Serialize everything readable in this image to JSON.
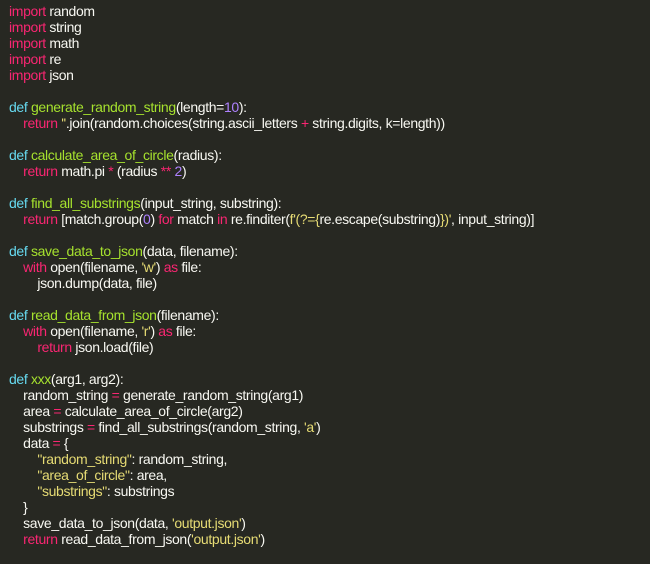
{
  "editor": {
    "colors": {
      "background": "#272822",
      "keyword": "#f92672",
      "function": "#a6e22e",
      "number": "#ae81ff",
      "string": "#e6db74",
      "text": "#f8f8f2",
      "builtin": "#66d9ef"
    },
    "lines": [
      [
        [
          "k",
          "import"
        ],
        [
          "t",
          " random"
        ]
      ],
      [
        [
          "k",
          "import"
        ],
        [
          "t",
          " string"
        ]
      ],
      [
        [
          "k",
          "import"
        ],
        [
          "t",
          " math"
        ]
      ],
      [
        [
          "k",
          "import"
        ],
        [
          "t",
          " re"
        ]
      ],
      [
        [
          "k",
          "import"
        ],
        [
          "t",
          " json"
        ]
      ],
      [],
      [
        [
          "b",
          "def "
        ],
        [
          "f",
          "generate_random_string"
        ],
        [
          "t",
          "(length="
        ],
        [
          "n",
          "10"
        ],
        [
          "t",
          "):"
        ]
      ],
      [
        [
          "t",
          "    "
        ],
        [
          "k",
          "return"
        ],
        [
          "t",
          " "
        ],
        [
          "s",
          "''"
        ],
        [
          "t",
          ".join(random.choices(string.ascii_letters "
        ],
        [
          "k",
          "+"
        ],
        [
          "t",
          " string.digits, k=length))"
        ]
      ],
      [],
      [
        [
          "b",
          "def "
        ],
        [
          "f",
          "calculate_area_of_circle"
        ],
        [
          "t",
          "(radius):"
        ]
      ],
      [
        [
          "t",
          "    "
        ],
        [
          "k",
          "return"
        ],
        [
          "t",
          " math.pi "
        ],
        [
          "k",
          "*"
        ],
        [
          "t",
          " (radius "
        ],
        [
          "k",
          "**"
        ],
        [
          "t",
          " "
        ],
        [
          "n",
          "2"
        ],
        [
          "t",
          ")"
        ]
      ],
      [],
      [
        [
          "b",
          "def "
        ],
        [
          "f",
          "find_all_substrings"
        ],
        [
          "t",
          "(input_string, substring):"
        ]
      ],
      [
        [
          "t",
          "    "
        ],
        [
          "k",
          "return"
        ],
        [
          "t",
          " [match.group("
        ],
        [
          "n",
          "0"
        ],
        [
          "t",
          ") "
        ],
        [
          "k",
          "for"
        ],
        [
          "t",
          " match "
        ],
        [
          "k",
          "in"
        ],
        [
          "t",
          " re.finditer("
        ],
        [
          "s",
          "f'(?={"
        ],
        [
          "t",
          "re.escape(substring)"
        ],
        [
          "s",
          "})'"
        ],
        [
          "t",
          ", input_string)]"
        ]
      ],
      [],
      [
        [
          "b",
          "def "
        ],
        [
          "f",
          "save_data_to_json"
        ],
        [
          "t",
          "(data, filename):"
        ]
      ],
      [
        [
          "t",
          "    "
        ],
        [
          "k",
          "with"
        ],
        [
          "t",
          " open(filename, "
        ],
        [
          "s",
          "'w'"
        ],
        [
          "t",
          ") "
        ],
        [
          "k",
          "as"
        ],
        [
          "t",
          " file:"
        ]
      ],
      [
        [
          "t",
          "        json.dump(data, file)"
        ]
      ],
      [],
      [
        [
          "b",
          "def "
        ],
        [
          "f",
          "read_data_from_json"
        ],
        [
          "t",
          "(filename):"
        ]
      ],
      [
        [
          "t",
          "    "
        ],
        [
          "k",
          "with"
        ],
        [
          "t",
          " open(filename, "
        ],
        [
          "s",
          "'r'"
        ],
        [
          "t",
          ") "
        ],
        [
          "k",
          "as"
        ],
        [
          "t",
          " file:"
        ]
      ],
      [
        [
          "t",
          "        "
        ],
        [
          "k",
          "return"
        ],
        [
          "t",
          " json.load(file)"
        ]
      ],
      [],
      [
        [
          "b",
          "def "
        ],
        [
          "f",
          "xxx"
        ],
        [
          "t",
          "(arg1, arg2):"
        ]
      ],
      [
        [
          "t",
          "    random_string "
        ],
        [
          "k",
          "="
        ],
        [
          "t",
          " generate_random_string(arg1)"
        ]
      ],
      [
        [
          "t",
          "    area "
        ],
        [
          "k",
          "="
        ],
        [
          "t",
          " calculate_area_of_circle(arg2)"
        ]
      ],
      [
        [
          "t",
          "    substrings "
        ],
        [
          "k",
          "="
        ],
        [
          "t",
          " find_all_substrings(random_string, "
        ],
        [
          "s",
          "'a'"
        ],
        [
          "t",
          ")"
        ]
      ],
      [
        [
          "t",
          "    data "
        ],
        [
          "k",
          "="
        ],
        [
          "t",
          " {"
        ]
      ],
      [
        [
          "t",
          "        "
        ],
        [
          "s",
          "\"random_string\""
        ],
        [
          "t",
          ": random_string,"
        ]
      ],
      [
        [
          "t",
          "        "
        ],
        [
          "s",
          "\"area_of_circle\""
        ],
        [
          "t",
          ": area,"
        ]
      ],
      [
        [
          "t",
          "        "
        ],
        [
          "s",
          "\"substrings\""
        ],
        [
          "t",
          ": substrings"
        ]
      ],
      [
        [
          "t",
          "    }"
        ]
      ],
      [
        [
          "t",
          "    save_data_to_json(data, "
        ],
        [
          "s",
          "'output.json'"
        ],
        [
          "t",
          ")"
        ]
      ],
      [
        [
          "t",
          "    "
        ],
        [
          "k",
          "return"
        ],
        [
          "t",
          " read_data_from_json("
        ],
        [
          "s",
          "'output.json'"
        ],
        [
          "t",
          ")"
        ]
      ]
    ]
  }
}
